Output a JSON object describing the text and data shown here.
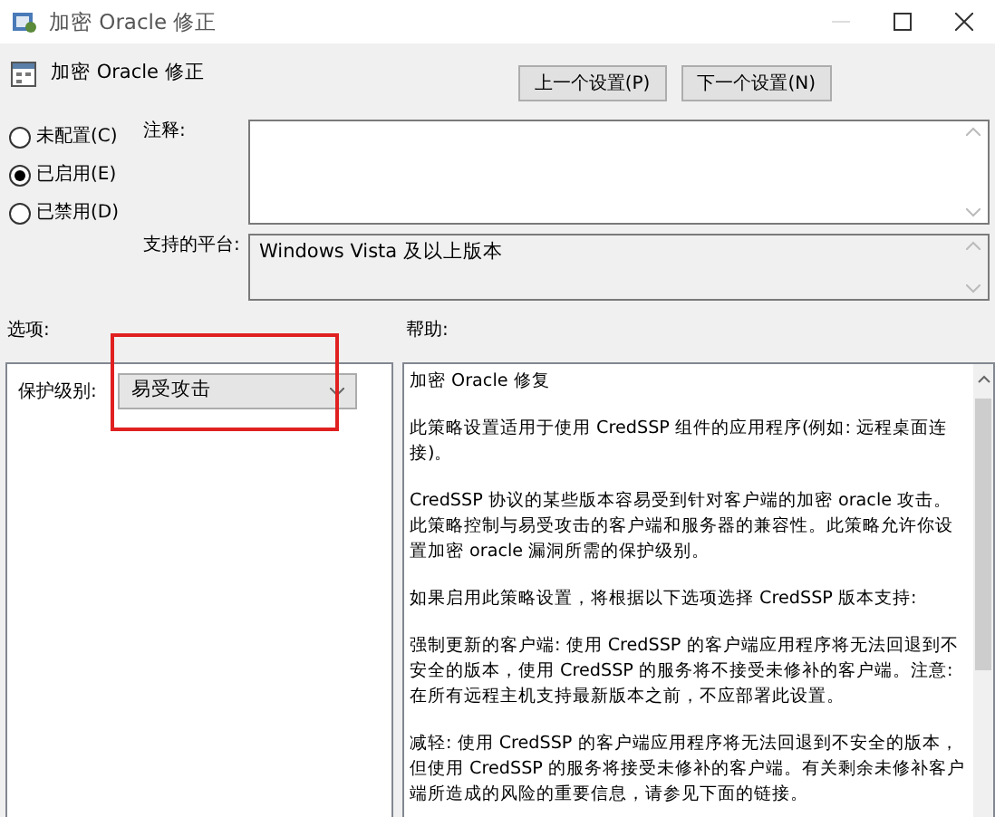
{
  "window": {
    "title": "加密 Oracle 修正"
  },
  "header": {
    "title": "加密 Oracle 修正"
  },
  "nav_buttons": [
    {
      "label": "上一个设置(P)"
    },
    {
      "label": "下一个设置(N)"
    }
  ],
  "states": [
    {
      "label": "未配置(C)",
      "selected": false
    },
    {
      "label": "已启用(E)",
      "selected": true
    },
    {
      "label": "已禁用(D)",
      "selected": false
    }
  ],
  "comment": {
    "label": "注释:"
  },
  "platform": {
    "label": "支持的平台:",
    "value": "Windows Vista 及以上版本"
  },
  "options": {
    "heading": "选项:",
    "items": [
      {
        "label": "保护级别:",
        "value": "易受攻击",
        "highlighted": true
      }
    ]
  },
  "help": {
    "heading": "帮助:",
    "paragraphs": [
      "加密 Oracle 修复",
      "此策略设置适用于使用 CredSSP 组件的应用程序(例如: 远程桌面连接)。",
      "CredSSP 协议的某些版本容易受到针对客户端的加密 oracle 攻击。此策略控制与易受攻击的客户端和服务器的兼容性。此策略允许你设置加密 oracle 漏洞所需的保护级别。",
      "如果启用此策略设置，将根据以下选项选择 CredSSP 版本支持:",
      "强制更新的客户端: 使用 CredSSP 的客户端应用程序将无法回退到不安全的版本，使用 CredSSP 的服务将不接受未修补的客户端。注意: 在所有远程主机支持最新版本之前，不应部署此设置。",
      "减轻: 使用 CredSSP 的客户端应用程序将无法回退到不安全的版本，但使用 CredSSP 的服务将接受未修补的客户端。有关剩余未修补客户端所造成的风险的重要信息，请参见下面的链接。"
    ]
  }
}
